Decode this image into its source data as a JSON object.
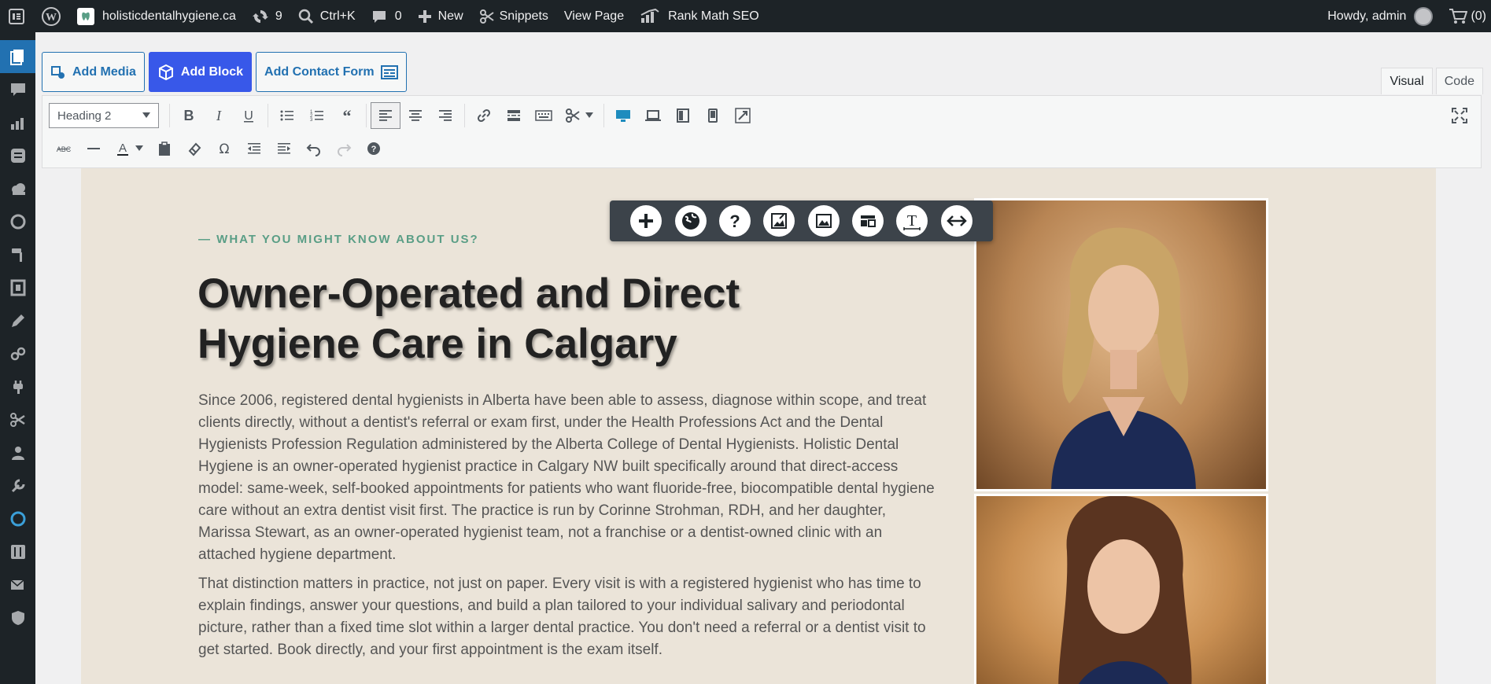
{
  "adminbar": {
    "site_name": "holisticdentalhygiene.ca",
    "updates_count": "9",
    "search_label": "Ctrl+K",
    "comments_count": "0",
    "new_label": "New",
    "snippets_label": "Snippets",
    "view_page_label": "View Page",
    "rank_math_label": "Rank Math SEO",
    "howdy_label": "Howdy, admin",
    "cart_label": "(0)"
  },
  "media_buttons": {
    "add_media": "Add Media",
    "add_block": "Add Block",
    "add_contact_form": "Add Contact Form"
  },
  "editor_tabs": {
    "visual": "Visual",
    "code": "Code"
  },
  "toolbar": {
    "format_select": "Heading 2"
  },
  "content": {
    "eyebrow": "— WHAT YOU MIGHT KNOW ABOUT US?",
    "heading_line1": "Owner-Operated and Direct",
    "heading_line2": "Hygiene Care in Calgary",
    "paragraph1": "Since 2006, registered dental hygienists in Alberta have been able to assess, diagnose within scope, and treat clients directly, without a dentist's referral or exam first, under the Health Professions Act and the Dental Hygienists Profession Regulation administered by the Alberta College of Dental Hygienists. Holistic Dental Hygiene is an owner-operated hygienist practice in Calgary NW built specifically around that direct-access model: same-week, self-booked appointments for patients who want fluoride-free, biocompatible dental hygiene care without an extra dentist visit first. The practice is run by Corinne Strohman, RDH, and her daughter, Marissa Stewart, as an owner-operated hygienist team, not a franchise or a dentist-owned clinic with an attached hygiene department.",
    "paragraph2": "That distinction matters in practice, not just on paper. Every visit is with a registered hygienist who has time to explain findings, answer your questions, and build a plan tailored to your individual salivary and periodontal picture, rather than a fixed time slot within a larger dental practice. You don't need a referral or a dentist visit to get started. Book directly, and your first appointment is the exam itself."
  },
  "colors": {
    "adminbar_bg": "#1d2327",
    "accent_blue": "#3858e9",
    "eyebrow_green": "#5a9e86",
    "canvas_bg": "#ebe4d9"
  }
}
